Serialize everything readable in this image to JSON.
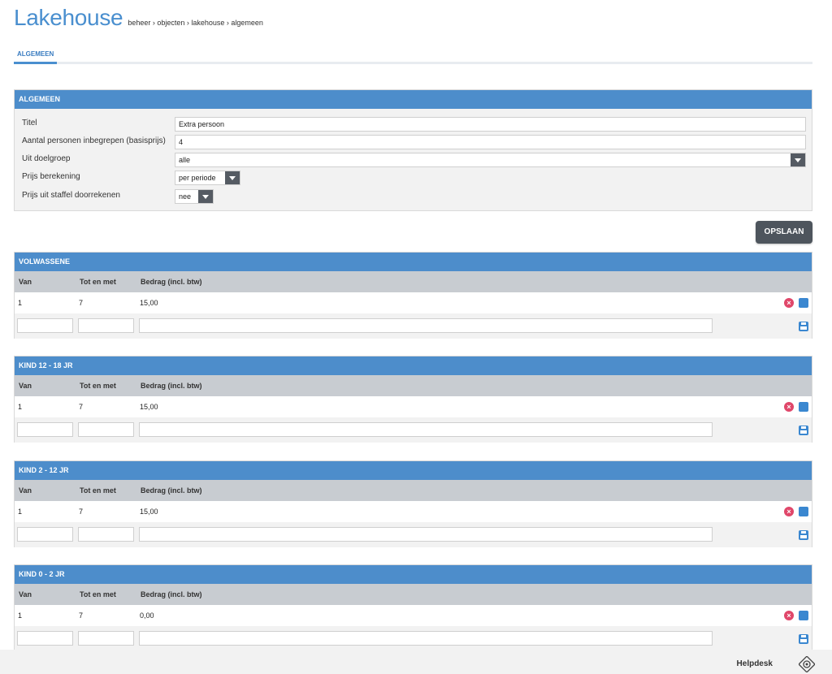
{
  "page": {
    "title": "Lakehouse",
    "breadcrumb": "beheer › objecten › lakehouse › algemeen"
  },
  "tabs": [
    {
      "label": "ALGEMEEN",
      "active": true
    }
  ],
  "general": {
    "header": "ALGEMEEN",
    "fields": {
      "titel": {
        "label": "Titel",
        "value": "Extra persoon"
      },
      "personen": {
        "label": "Aantal personen inbegrepen (basisprijs)",
        "value": "4"
      },
      "doelgroep": {
        "label": "Uit doelgroep",
        "value": "alle"
      },
      "berekening": {
        "label": "Prijs berekening",
        "value": "per periode"
      },
      "staffel": {
        "label": "Prijs uit staffel doorrekenen",
        "value": "nee"
      }
    }
  },
  "save_button": "OPSLAAN",
  "columns": {
    "van": "Van",
    "tot": "Tot en met",
    "bedrag": "Bedrag (incl. btw)"
  },
  "price_tables": [
    {
      "title": "VOLWASSENE",
      "rows": [
        {
          "van": "1",
          "tot": "7",
          "bedrag": "15,00"
        }
      ]
    },
    {
      "title": "KIND 12 - 18 JR",
      "rows": [
        {
          "van": "1",
          "tot": "7",
          "bedrag": "15,00"
        }
      ]
    },
    {
      "title": "KIND 2 - 12 JR",
      "rows": [
        {
          "van": "1",
          "tot": "7",
          "bedrag": "15,00"
        }
      ]
    },
    {
      "title": "KIND 0 - 2 JR",
      "rows": [
        {
          "van": "1",
          "tot": "7",
          "bedrag": "0,00"
        }
      ]
    }
  ],
  "footer": {
    "helpdesk": "Helpdesk"
  },
  "colors": {
    "accent": "#4d8dcb",
    "delete": "#e0476a",
    "button": "#4e555d"
  }
}
